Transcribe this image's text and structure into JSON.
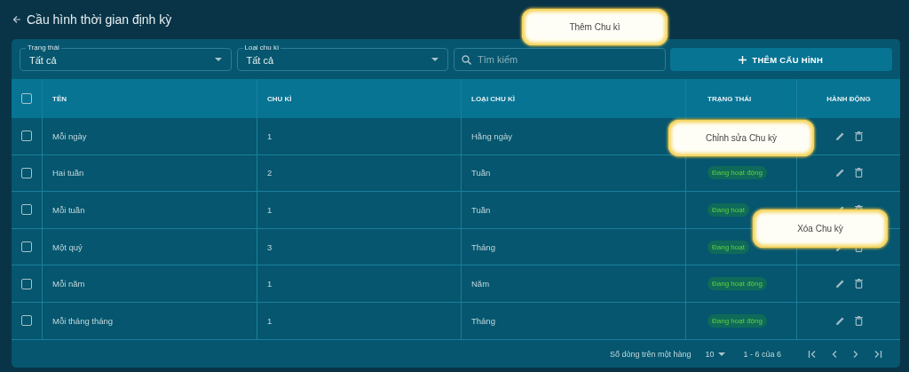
{
  "page": {
    "title": "Cầu hình thời gian định kỳ"
  },
  "filters": [
    {
      "label": "Trạng thái",
      "value": "Tất cả"
    },
    {
      "label": "Loại chu kì",
      "value": "Tất cả"
    }
  ],
  "search": {
    "placeholder": "Tìm kiếm"
  },
  "add_button": {
    "label": "THÊM CẤU HÌNH"
  },
  "table": {
    "select_all": {
      "checked": false
    },
    "columns": [
      "TÊN",
      "CHU KÌ",
      "LOẠI CHU KÌ",
      "TRẠNG THÁI",
      "HÀNH ĐỘNG"
    ],
    "rows": [
      {
        "name": "Mỗi ngày",
        "cycle": "1",
        "cycle_type": "Hằng ngày",
        "checked": false
      },
      {
        "name": "Hai tuần",
        "cycle": "2",
        "cycle_type": "Tuần",
        "status": "Đang hoạt động",
        "checked": false
      },
      {
        "name": "Mỗi tuần",
        "cycle": "1",
        "cycle_type": "Tuần",
        "status": "Đang hoạt",
        "checked": false
      },
      {
        "name": "Một quý",
        "cycle": "3",
        "cycle_type": "Tháng",
        "status": "Đang hoạt",
        "checked": false
      },
      {
        "name": "Mỗi năm",
        "cycle": "1",
        "cycle_type": "Năm",
        "status": "Đang hoạt động",
        "checked": false
      },
      {
        "name": "Mỗi tháng tháng",
        "cycle": "1",
        "cycle_type": "Tháng",
        "status": "Đang hoạt động",
        "checked": false
      }
    ]
  },
  "pagination": {
    "rows_label": "Số dòng trên một hàng",
    "rows_per_page": "10",
    "range": "1 - 6 của 6"
  },
  "callouts": [
    {
      "text": "Thêm Chu kì"
    },
    {
      "text": "Chỉnh sửa Chu kỳ"
    },
    {
      "text": "Xóa Chu kỳ"
    }
  ]
}
